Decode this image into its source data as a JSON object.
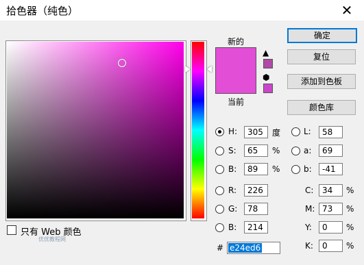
{
  "window": {
    "title": "拾色器（纯色）",
    "close_glyph": "✕"
  },
  "colors": {
    "new": "#e24ed6",
    "current": "#e24ed6",
    "warn_swatch": "#b04aa8",
    "web_swatch": "#cc44cc",
    "accent": "#0078d7"
  },
  "swatch": {
    "new_label": "新的",
    "current_label": "当前",
    "warn_icon": "▲",
    "cube_icon": "⬢"
  },
  "buttons": {
    "ok": "确定",
    "reset": "复位",
    "add_to_swatches": "添加到色板",
    "color_library": "颜色库"
  },
  "hsb": {
    "h": {
      "label": "H:",
      "value": "305",
      "unit": "度",
      "checked": true
    },
    "s": {
      "label": "S:",
      "value": "65",
      "unit": "%"
    },
    "b": {
      "label": "B:",
      "value": "89",
      "unit": "%"
    }
  },
  "lab": {
    "l": {
      "label": "L:",
      "value": "58"
    },
    "a": {
      "label": "a:",
      "value": "69"
    },
    "b": {
      "label": "b:",
      "value": "-41"
    }
  },
  "rgb": {
    "r": {
      "label": "R:",
      "value": "226"
    },
    "g": {
      "label": "G:",
      "value": "78"
    },
    "b": {
      "label": "B:",
      "value": "214"
    }
  },
  "cmyk": {
    "c": {
      "label": "C:",
      "value": "34",
      "unit": "%"
    },
    "m": {
      "label": "M:",
      "value": "73",
      "unit": "%"
    },
    "y": {
      "label": "Y:",
      "value": "0",
      "unit": "%"
    },
    "k": {
      "label": "K:",
      "value": "0",
      "unit": "%"
    }
  },
  "hex": {
    "label": "#",
    "value": "e24ed6"
  },
  "web_only": {
    "label": "只有 Web 颜色",
    "checked": false
  },
  "watermark": "优优教程网"
}
